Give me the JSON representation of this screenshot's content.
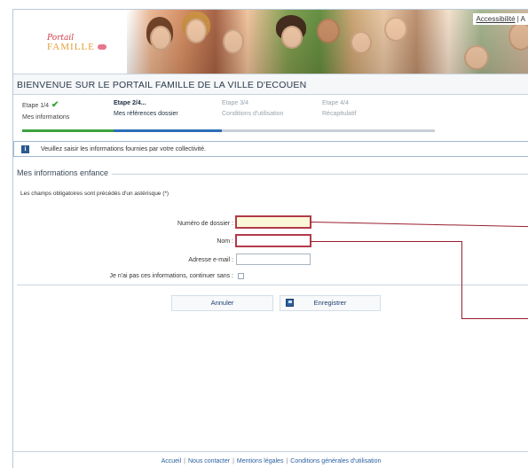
{
  "header": {
    "logo_top": "Portail",
    "logo_bottom": "FAMILLE",
    "accessibility_link": "Accessibilité",
    "accessibility_sep": "|",
    "accessibility_next": "A"
  },
  "page_title": "BIENVENUE SUR LE PORTAIL FAMILLE DE LA VILLE D'ECOUEN",
  "steps": [
    {
      "title": "Etape 1/4",
      "subtitle": "Mes informations",
      "state": "done"
    },
    {
      "title": "Etape 2/4...",
      "subtitle": "Mes références dossier",
      "state": "active"
    },
    {
      "title": "Etape 3/4",
      "subtitle": "Conditions d'utilisation",
      "state": "future"
    },
    {
      "title": "Etape 4/4",
      "subtitle": "Récapitulatif",
      "state": "future"
    }
  ],
  "progress_colors": {
    "done": "#3aa33a",
    "active": "#2c6fb7",
    "future": "#c9cfd6"
  },
  "info_message": "Veuillez saisir les informations fournies par votre collectivité.",
  "form": {
    "legend": "Mes informations enfance",
    "required_note": "Les champs obligatoires sont précédés d'un astérisque (*)",
    "fields": {
      "dossier_label": "Numéro de dossier :",
      "dossier_value": "",
      "nom_label": "Nom :",
      "nom_value": "",
      "email_label": "Adresse e-mail :",
      "email_value": "",
      "skip_label": "Je n'ai pas ces informations, continuer sans :"
    }
  },
  "buttons": {
    "cancel": "Annuler",
    "save": "Enregistrer"
  },
  "footer": {
    "links": [
      "Accueil",
      "Nous contacter",
      "Mentions légales",
      "Conditions générales d'utilisation"
    ],
    "separator": "|"
  },
  "colors": {
    "accent_red": "#b33a4a",
    "link_blue": "#2b5fa0",
    "focus_fill": "#fbf8d8"
  }
}
